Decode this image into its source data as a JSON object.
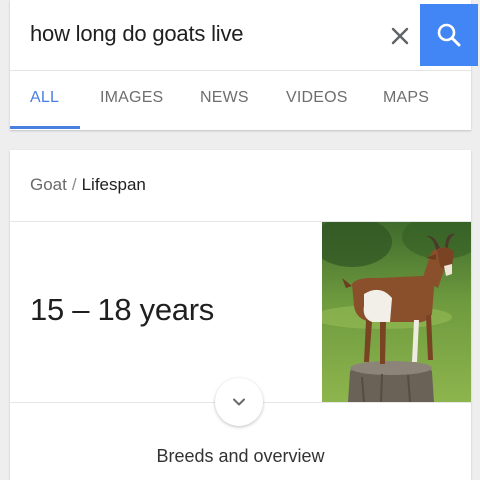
{
  "search": {
    "query": "how long do goats live"
  },
  "tabs": [
    {
      "label": "ALL",
      "active": true
    },
    {
      "label": "IMAGES",
      "active": false
    },
    {
      "label": "NEWS",
      "active": false
    },
    {
      "label": "VIDEOS",
      "active": false
    },
    {
      "label": "MAPS",
      "active": false
    }
  ],
  "card": {
    "breadcrumb_parent": "Goat",
    "breadcrumb_separator": "/",
    "breadcrumb_current": "Lifespan",
    "answer": "15 – 18 years",
    "expand_label": "Breeds and overview"
  },
  "colors": {
    "accent": "#4285f4",
    "tab_active": "#4a7fe0"
  },
  "icons": {
    "clear": "close-icon",
    "search": "search-icon",
    "expand": "chevron-down-icon"
  }
}
